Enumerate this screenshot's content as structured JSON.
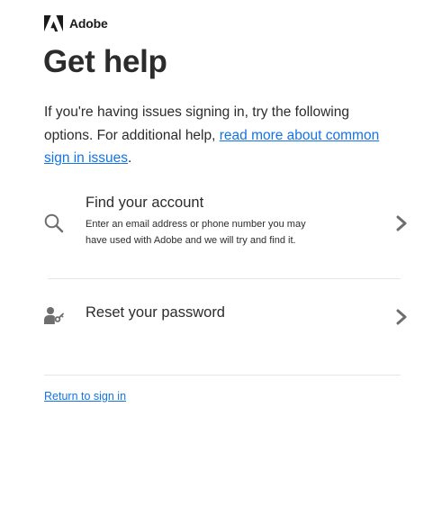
{
  "brand": {
    "name": "Adobe",
    "logo_icon": "adobe-logo-icon",
    "color": "#1a1a1a"
  },
  "page_title": "Get help",
  "intro": {
    "text_before_link": "If you're having issues signing in, try the following options. For additional help, ",
    "link_text": "read more about common sign in issues",
    "text_after_link": "."
  },
  "options": [
    {
      "icon": "search-icon",
      "title": "Find your account",
      "description": "Enter an email address or phone number you may have used with Adobe and we will try and find it."
    },
    {
      "icon": "user-key-icon",
      "title": "Reset your password",
      "description": ""
    }
  ],
  "footer": {
    "return_link": "Return to sign in"
  },
  "colors": {
    "link": "#1473e6",
    "text": "#2c2c2c",
    "divider": "#e6e6e6",
    "icon": "#6e6e6e"
  }
}
